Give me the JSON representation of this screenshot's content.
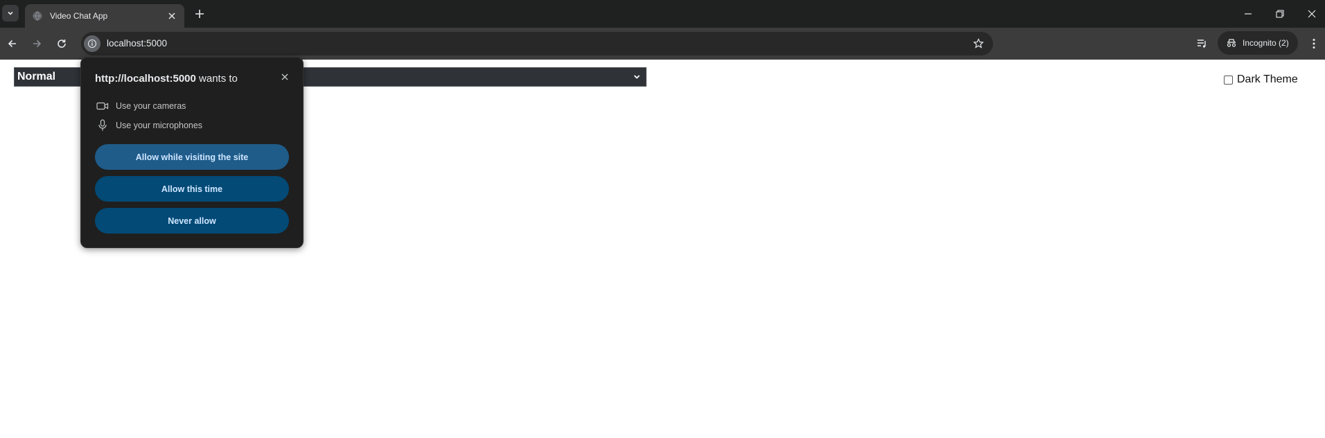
{
  "browser": {
    "tab": {
      "title": "Video Chat App"
    },
    "omnibox": {
      "url": "localhost:5000"
    },
    "incognito": {
      "label": "Incognito (2)"
    }
  },
  "page": {
    "mode_select": {
      "value": "Normal"
    },
    "theme_toggle": {
      "label": "Dark Theme",
      "checked": false
    }
  },
  "permission_prompt": {
    "origin": "http://localhost:5000",
    "suffix": " wants to",
    "permissions": [
      {
        "icon": "camera-icon",
        "label": "Use your cameras"
      },
      {
        "icon": "microphone-icon",
        "label": "Use your microphones"
      }
    ],
    "buttons": {
      "allow_visit": "Allow while visiting the site",
      "allow_once": "Allow this time",
      "never": "Never allow"
    }
  },
  "colors": {
    "tabstrip_bg": "#1f2020",
    "toolbar_bg": "#3c3c3c",
    "bubble_bg": "#1f1f1f",
    "button_primary": "#1f5c8a",
    "button_secondary": "#034a76",
    "select_bg": "#2f3338"
  }
}
